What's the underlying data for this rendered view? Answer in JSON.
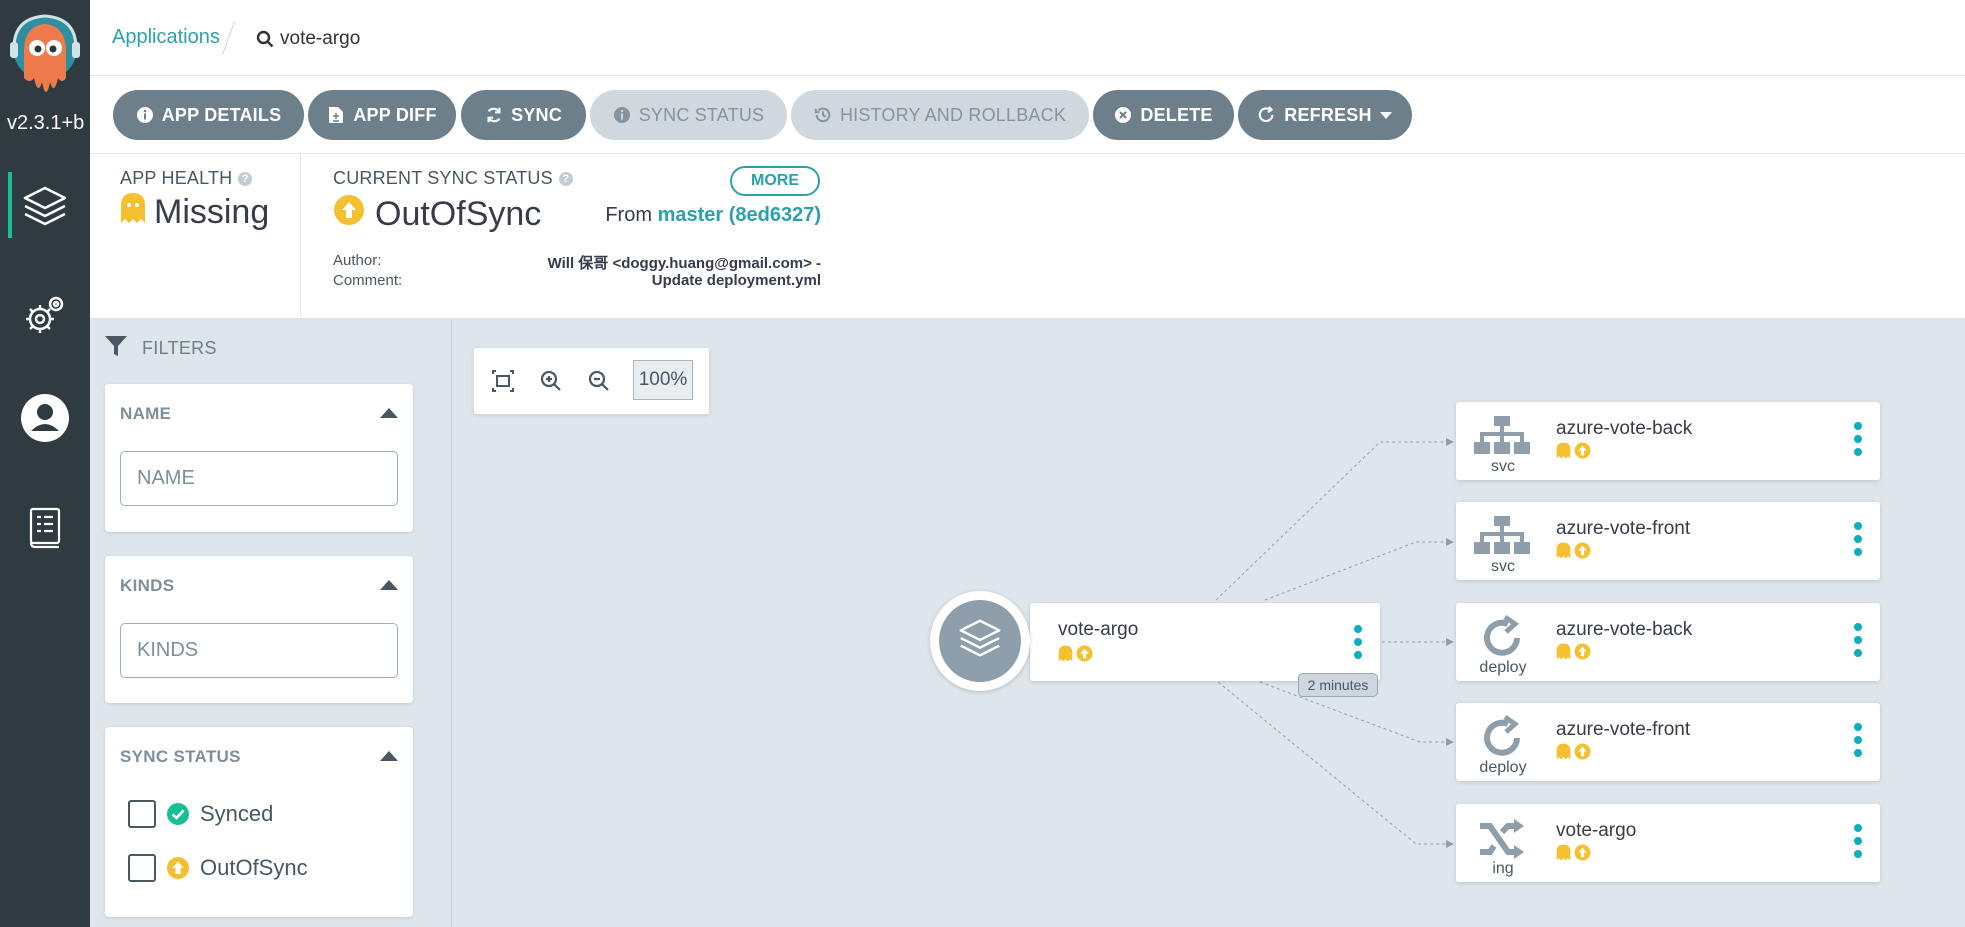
{
  "nav": {
    "version": "v2.3.1+b"
  },
  "breadcrumb": {
    "applications": "Applications",
    "current": "vote-argo"
  },
  "toolbar": {
    "app_details": "APP DETAILS",
    "app_diff": "APP DIFF",
    "sync": "SYNC",
    "sync_status": "SYNC STATUS",
    "history": "HISTORY AND ROLLBACK",
    "delete": "DELETE",
    "refresh": "REFRESH"
  },
  "status": {
    "health_label": "APP HEALTH",
    "health_value": "Missing",
    "sync_label": "CURRENT SYNC STATUS",
    "sync_value": "OutOfSync",
    "more": "MORE",
    "from_prefix": "From",
    "from_rev": "master (8ed6327)",
    "author_label": "Author:",
    "author_value": "Will 保哥 <doggy.huang@gmail.com> -",
    "comment_label": "Comment:",
    "comment_value": "Update deployment.yml"
  },
  "filters": {
    "title": "FILTERS",
    "name_title": "NAME",
    "name_placeholder": "NAME",
    "kinds_title": "KINDS",
    "kinds_placeholder": "KINDS",
    "sync_title": "SYNC STATUS",
    "synced": "Synced",
    "outofsync": "OutOfSync"
  },
  "graph": {
    "zoom": "100%",
    "app": {
      "name": "vote-argo",
      "age": "2 minutes"
    },
    "resources": [
      {
        "name": "azure-vote-back",
        "kind": "svc"
      },
      {
        "name": "azure-vote-front",
        "kind": "svc"
      },
      {
        "name": "azure-vote-back",
        "kind": "deploy"
      },
      {
        "name": "azure-vote-front",
        "kind": "deploy"
      },
      {
        "name": "vote-argo",
        "kind": "ing"
      }
    ]
  },
  "colors": {
    "nav_bg": "#303a41",
    "accent": "#2aa1ab",
    "button": "#6d7f8b",
    "missing": "#f4c030",
    "outofsync": "#f4c030",
    "synced": "#18be94"
  }
}
